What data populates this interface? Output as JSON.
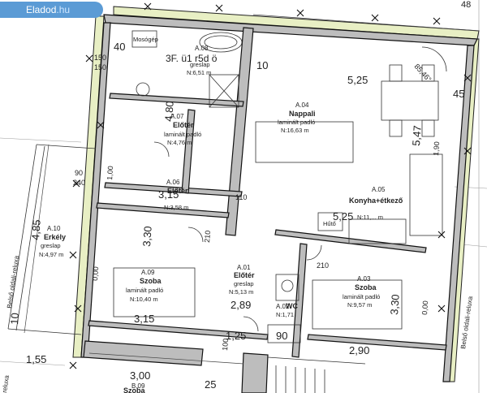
{
  "watermark": {
    "brand": "Eladod",
    "tld": ".hu"
  },
  "header": {
    "title": "3F. ü1 r5d ö",
    "corner_dim": "48"
  },
  "rooms": [
    {
      "code": "A.08",
      "name": "",
      "floor": "greslap",
      "area": "N:6,51 m"
    },
    {
      "code": "A.07",
      "name": "Előtér",
      "floor": "laminált padló",
      "area": "N:4,76 m"
    },
    {
      "code": "A.06",
      "name": "Előtér",
      "floor": "",
      "area": "N:3,58 m"
    },
    {
      "code": "A.04",
      "name": "Nappali",
      "floor": "laminált padló",
      "area": "N:16,63 m"
    },
    {
      "code": "A.05",
      "name": "Konyha+étkező",
      "floor": "",
      "area": "N:11,... m"
    },
    {
      "code": "A.10",
      "name": "Erkély",
      "floor": "greslap",
      "area": "N:4,97 m"
    },
    {
      "code": "A.09",
      "name": "Szoba",
      "floor": "laminált padló",
      "area": "N:10,40 m"
    },
    {
      "code": "A.01",
      "name": "Előtér",
      "floor": "greslap",
      "area": "N:5,13 m"
    },
    {
      "code": "A.03",
      "name": "Szoba",
      "floor": "laminált padló",
      "area": "N:9,57 m"
    },
    {
      "code": "A.02",
      "name": "WC",
      "floor": "",
      "area": "N:1,71"
    },
    {
      "code": "B.09",
      "name": "Szoba",
      "floor": "",
      "area": ""
    }
  ],
  "dimensions": [
    "5,25",
    "5,47",
    "4,80",
    "3,15",
    "4,85",
    "3,30",
    "3,15",
    "5,25",
    "3,30",
    "2,90",
    "1,55",
    "3,00",
    "1,25",
    "2,89",
    "90",
    "10",
    "85,46°",
    "45",
    "40",
    "25",
    "10",
    "90",
    "210",
    "210",
    "100",
    "110",
    "240",
    "150",
    "150",
    "1,90",
    "0,00",
    "0,00",
    "1,00"
  ],
  "labels": {
    "moso": "Mosógép",
    "hutö": "Hűtő",
    "reluxa_left": "Belső oldali-reluxa",
    "reluxa_right": "Belső oldali-reluxa",
    "reluxa_bottom": "reluxa"
  }
}
